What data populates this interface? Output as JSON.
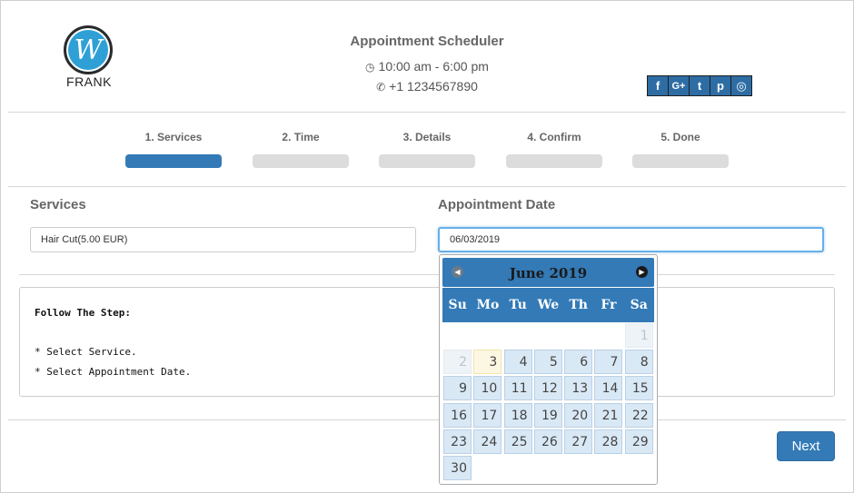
{
  "header": {
    "logo_letter": "W",
    "logo_name": "FRANK",
    "title": "Appointment Scheduler",
    "hours": "10:00 am - 6:00 pm",
    "phone": "+1 1234567890",
    "hours_icon": "clock-icon",
    "phone_icon": "phone-icon"
  },
  "social": [
    {
      "name": "facebook-icon",
      "glyph": "f"
    },
    {
      "name": "google-plus-icon",
      "glyph": "G+"
    },
    {
      "name": "twitter-icon",
      "glyph": "t"
    },
    {
      "name": "pinterest-icon",
      "glyph": "p"
    },
    {
      "name": "instagram-icon",
      "glyph": "◎"
    }
  ],
  "steps": [
    {
      "label": "1. Services",
      "active": true
    },
    {
      "label": "2. Time",
      "active": false
    },
    {
      "label": "3. Details",
      "active": false
    },
    {
      "label": "4. Confirm",
      "active": false
    },
    {
      "label": "5. Done",
      "active": false
    }
  ],
  "form": {
    "services_label": "Services",
    "services_value": "Hair Cut(5.00 EUR)",
    "date_label": "Appointment Date",
    "date_value": "06/03/2019"
  },
  "info": {
    "title": "Follow The Step:",
    "line1": "* Select Service.",
    "line2": "* Select Appointment Date."
  },
  "next_label": "Next",
  "calendar": {
    "month": "June 2019",
    "days_of_week": [
      "Su",
      "Mo",
      "Tu",
      "We",
      "Th",
      "Fr",
      "Sa"
    ],
    "first_weekday": 6,
    "days_in_month": 30,
    "disabled_days": [
      1,
      2
    ],
    "today": 3
  },
  "colors": {
    "primary": "#337ab7",
    "day_bg": "#d9e8f5",
    "today_bg": "#fcf7e3"
  }
}
